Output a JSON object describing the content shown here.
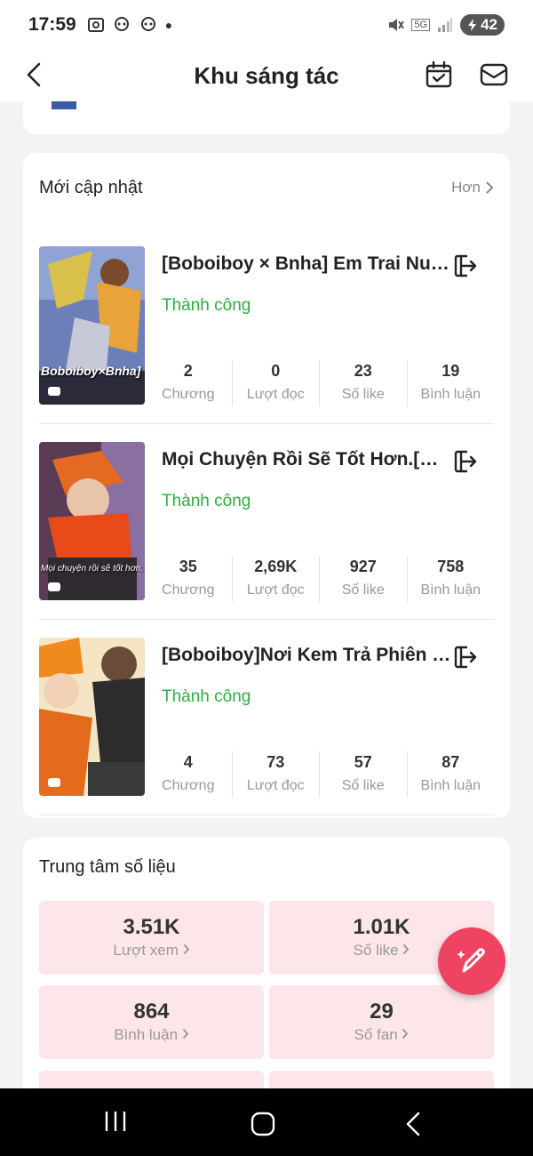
{
  "status_bar": {
    "time": "17:59",
    "network": "5G",
    "battery": "42"
  },
  "header": {
    "title": "Khu sáng tác"
  },
  "updates": {
    "heading": "Mới cập nhật",
    "more": "Hơn",
    "stories": [
      {
        "title": "[Boboiboy × Bnha] Em Trai Nuôi Của Villain?",
        "status": "Thành công",
        "cover_caption": "Boboiboy×Bnha]",
        "stats": [
          {
            "value": "2",
            "label": "Chương"
          },
          {
            "value": "0",
            "label": "Lượt đọc"
          },
          {
            "value": "23",
            "label": "Số like"
          },
          {
            "value": "19",
            "label": "Bình luận"
          }
        ]
      },
      {
        "title": "Mọi Chuyện Rồi Sẽ Tốt Hơn.[All Boboiboy]",
        "status": "Thành công",
        "cover_caption": "Mọi chuyện rồi sẽ tốt hơn.",
        "stats": [
          {
            "value": "35",
            "label": "Chương"
          },
          {
            "value": "2,69K",
            "label": "Lượt đọc"
          },
          {
            "value": "927",
            "label": "Số like"
          },
          {
            "value": "758",
            "label": "Bình luận"
          }
        ]
      },
      {
        "title": "[Boboiboy]Nơi Kem Trả Phiên Ngoại",
        "status": "Thành công",
        "cover_caption": "",
        "stats": [
          {
            "value": "4",
            "label": "Chương"
          },
          {
            "value": "73",
            "label": "Lượt đọc"
          },
          {
            "value": "57",
            "label": "Số like"
          },
          {
            "value": "87",
            "label": "Bình luận"
          }
        ]
      }
    ]
  },
  "data_center": {
    "heading": "Trung tâm số liệu",
    "tiles": [
      {
        "value": "3.51K",
        "label": "Lượt xem"
      },
      {
        "value": "1.01K",
        "label": "Số like"
      },
      {
        "value": "864",
        "label": "Bình luận"
      },
      {
        "value": "29",
        "label": "Số fan"
      }
    ]
  },
  "colors": {
    "accent": "#ee4461",
    "success": "#2fae3f",
    "tile_bg": "#fde6ea"
  },
  "icons": {
    "back": "back-arrow-icon",
    "calendar": "calendar-check-icon",
    "mail": "mail-icon",
    "export": "export-icon",
    "fab": "pencil-sparkle-icon"
  }
}
